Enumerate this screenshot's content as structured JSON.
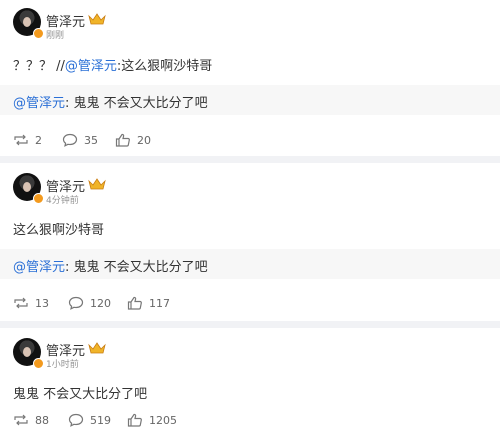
{
  "posts": [
    {
      "author": "管泽元",
      "time": "刚刚",
      "text_prefix": "？？？ //",
      "text_mention": "@管泽元",
      "text_suffix": ":这么狠啊沙特哥",
      "quote_mention": "@管泽元",
      "quote_text": ": 鬼鬼 不会又大比分了吧",
      "reposts": "2",
      "comments": "35",
      "likes": "20"
    },
    {
      "author": "管泽元",
      "time": "4分钟前",
      "text": "这么狠啊沙特哥",
      "quote_mention": "@管泽元",
      "quote_text": ": 鬼鬼 不会又大比分了吧",
      "reposts": "13",
      "comments": "120",
      "likes": "117"
    },
    {
      "author": "管泽元",
      "time": "1小时前",
      "text": "鬼鬼 不会又大比分了吧",
      "reposts": "88",
      "comments": "519",
      "likes": "1205"
    }
  ],
  "colors": {
    "mention": "#2a6fd6",
    "vip_badge": "#f39a1e",
    "crown": "#f0b429"
  },
  "icons": [
    "repost-icon",
    "comment-icon",
    "like-icon",
    "crown-icon",
    "verified-icon"
  ]
}
